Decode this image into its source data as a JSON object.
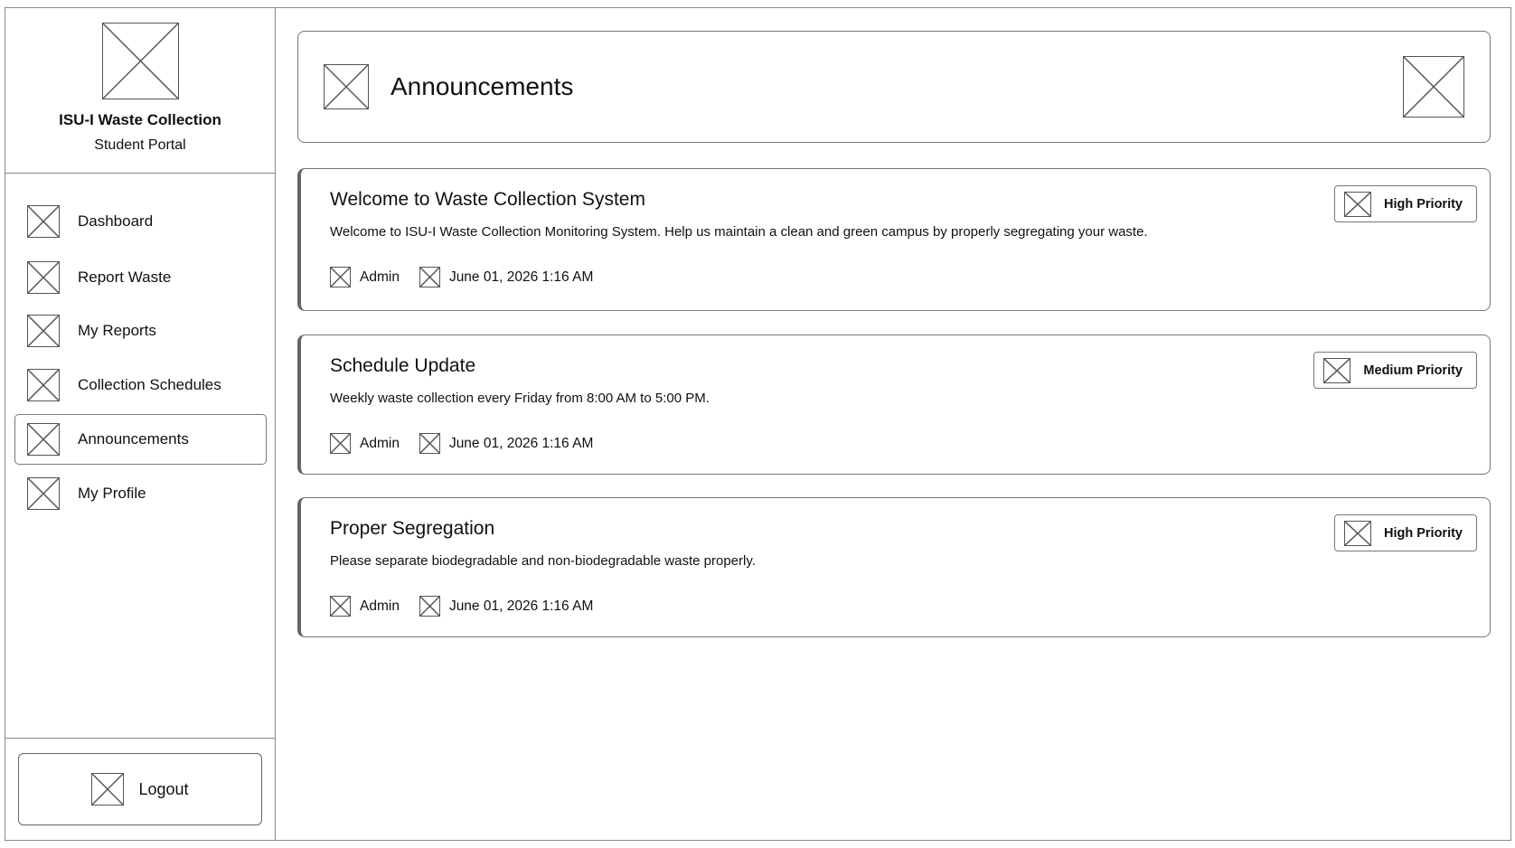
{
  "brand": {
    "logo_icon": "image-placeholder-icon",
    "title": "ISU-I Waste Collection",
    "subtitle": "Student Portal"
  },
  "sidebar": {
    "items": [
      {
        "label": "Dashboard",
        "icon": "image-placeholder-icon",
        "active": false
      },
      {
        "label": "Report Waste",
        "icon": "image-placeholder-icon",
        "active": false
      },
      {
        "label": "My Reports",
        "icon": "image-placeholder-icon",
        "active": false
      },
      {
        "label": "Collection Schedules",
        "icon": "image-placeholder-icon",
        "active": false
      },
      {
        "label": "Announcements",
        "icon": "image-placeholder-icon",
        "active": true
      },
      {
        "label": "My Profile",
        "icon": "image-placeholder-icon",
        "active": false
      }
    ],
    "logout_label": "Logout"
  },
  "header": {
    "title": "Announcements"
  },
  "announcements": [
    {
      "title": "Welcome to Waste Collection System",
      "body": "Welcome to ISU-I Waste Collection Monitoring System. Help us maintain a clean and green campus by properly segregating your waste.",
      "author": "Admin",
      "date": "June 01, 2026 1:16 AM",
      "priority": "High Priority"
    },
    {
      "title": "Schedule Update",
      "body": "Weekly waste collection every Friday from 8:00 AM to 5:00 PM.",
      "author": "Admin",
      "date": "June 01, 2026 1:16 AM",
      "priority": "Medium Priority"
    },
    {
      "title": "Proper Segregation",
      "body": "Please separate biodegradable and non-biodegradable waste properly.",
      "author": "Admin",
      "date": "June 01, 2026 1:16 AM",
      "priority": "High Priority"
    }
  ]
}
